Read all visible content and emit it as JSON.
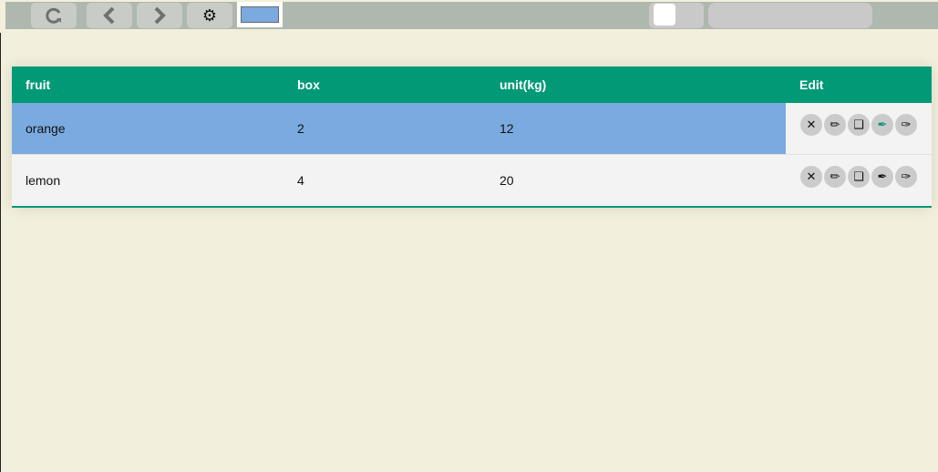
{
  "toolbar": {
    "refresh_icon": "refresh-icon",
    "back_icon": "chevron-left-icon",
    "forward_icon": "chevron-right-icon",
    "settings_glyph": "⚙",
    "color_swatch": "#7aaadf"
  },
  "table": {
    "headers": [
      "fruit",
      "box",
      "unit(kg)",
      "Edit"
    ],
    "rows": [
      {
        "fruit": "orange",
        "box": "2",
        "unit": "12",
        "selected": true
      },
      {
        "fruit": "lemon",
        "box": "4",
        "unit": "20",
        "selected": false
      }
    ],
    "actions": [
      {
        "name": "delete-icon",
        "glyph": "✕"
      },
      {
        "name": "pencil-icon",
        "glyph": "✏"
      },
      {
        "name": "copy-icon",
        "glyph": "❑"
      },
      {
        "name": "pen-nib-icon",
        "glyph": "✒"
      },
      {
        "name": "pencil-outline-icon",
        "glyph": "✑"
      }
    ]
  },
  "colors": {
    "accent": "#029977",
    "selected_row": "#7aaadf",
    "background": "#f2f0dc"
  }
}
